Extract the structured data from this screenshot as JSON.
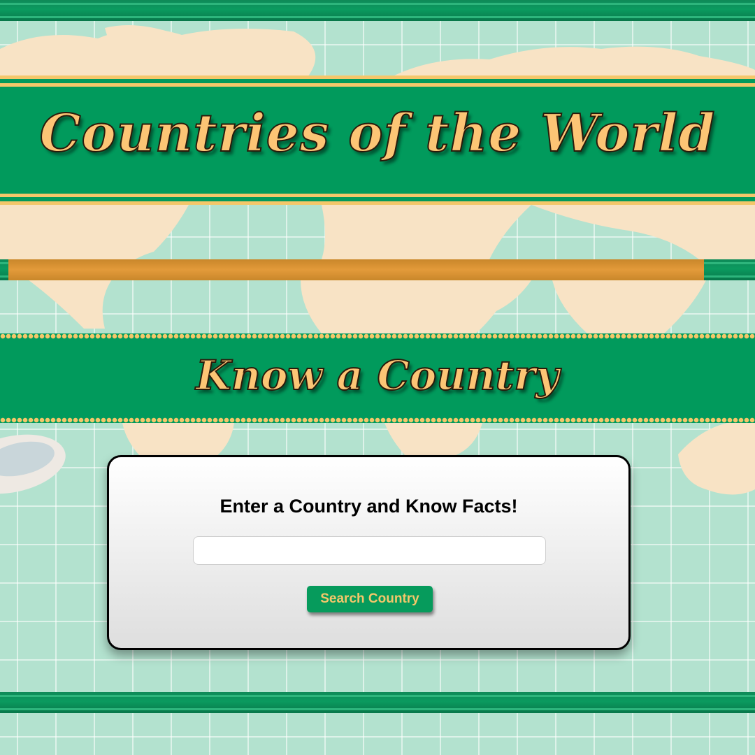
{
  "header": {
    "title": "Countries of the World"
  },
  "banner": {
    "subtitle": "Know a Country"
  },
  "search": {
    "heading": "Enter a Country and Know Facts!",
    "input_value": "",
    "placeholder": "",
    "button_label": "Search Country"
  },
  "colors": {
    "banner_green": "#019a5c",
    "gold": "#fcc575",
    "map_land": "#f8e3c5",
    "ocean": "#b3e2cf"
  }
}
